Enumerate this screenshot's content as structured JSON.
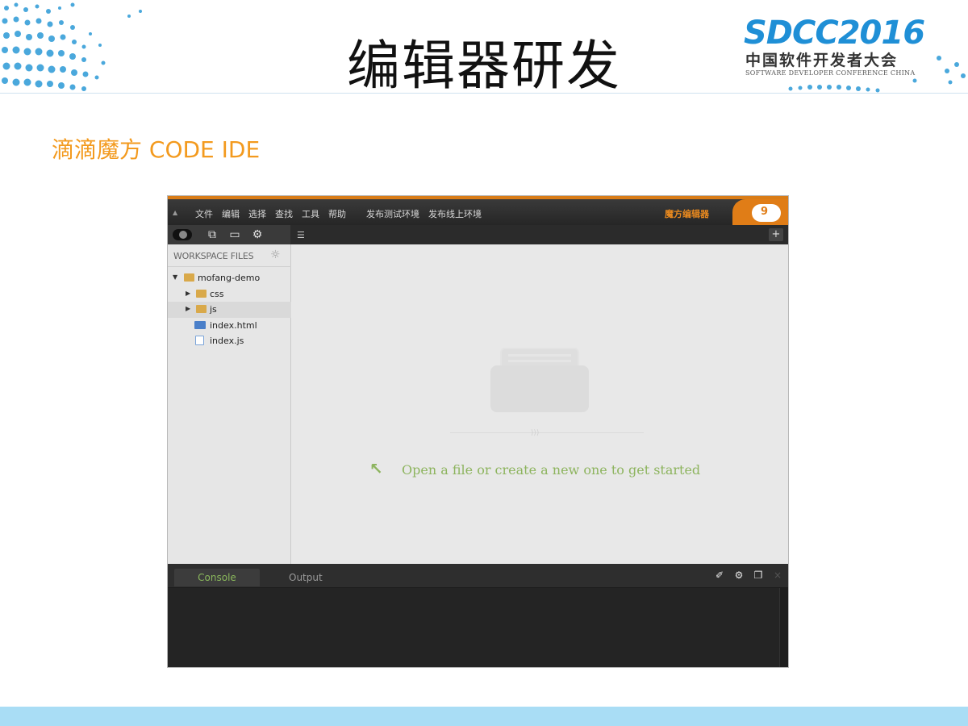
{
  "slide": {
    "title": "编辑器研发",
    "subtitle": "滴滴魔方 CODE IDE"
  },
  "logo": {
    "main": "SDCC2016",
    "cn": "中国软件开发者大会",
    "en": "SOFTWARE DEVELOPER CONFERENCE CHINA"
  },
  "ide": {
    "menus": [
      "文件",
      "编辑",
      "选择",
      "查找",
      "工具",
      "帮助"
    ],
    "publish_test": "发布测试环境",
    "publish_live": "发布线上环境",
    "brand": "魔方编辑器",
    "badge": "9",
    "toolbar_plus": "+",
    "sidebar": {
      "title": "WORKSPACE FILES",
      "tree": [
        {
          "label": "mofang-demo",
          "type": "folder",
          "expanded": true,
          "depth": 0
        },
        {
          "label": "css",
          "type": "folder",
          "expanded": false,
          "depth": 1
        },
        {
          "label": "js",
          "type": "folder",
          "expanded": false,
          "depth": 1,
          "selected": true
        },
        {
          "label": "index.html",
          "type": "file-html",
          "depth": 1
        },
        {
          "label": "index.js",
          "type": "file-js",
          "depth": 1
        }
      ]
    },
    "editor": {
      "hint": "Open a file or create a new one to get started"
    },
    "console": {
      "tabs": [
        "Console",
        "Output"
      ],
      "active_tab": "Console"
    }
  },
  "colors": {
    "accent_orange": "#f39a1e",
    "hint_green": "#8db45e",
    "logo_blue": "#1f8fd6",
    "footer_blue": "#a9ddf5"
  }
}
